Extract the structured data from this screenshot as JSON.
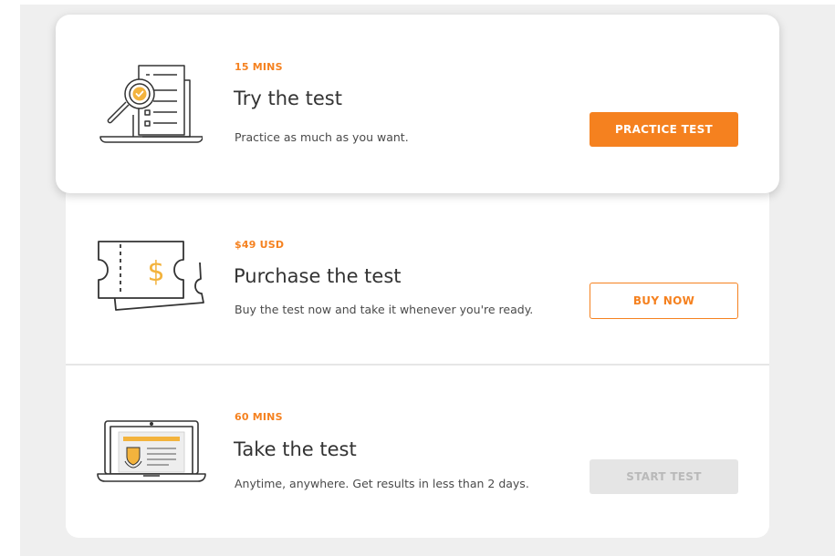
{
  "colors": {
    "accent": "#f5811f",
    "illustration_accent": "#f3b33d",
    "disabled_bg": "#e5e5e5",
    "disabled_text": "#b9b9b9",
    "page_bg": "#efefef"
  },
  "steps": [
    {
      "meta": "15 MINS",
      "title": "Try the test",
      "description": "Practice as much as you want.",
      "button_label": "PRACTICE TEST",
      "button_state": "primary",
      "icon": "laptop-magnifier-checklist-icon"
    },
    {
      "meta": "$49 USD",
      "title": "Purchase the test",
      "description": "Buy the test now and take it whenever you're ready.",
      "button_label": "BUY NOW",
      "button_state": "outline",
      "icon": "dollar-ticket-icon"
    },
    {
      "meta": "60 MINS",
      "title": "Take the test",
      "description": "Anytime, anywhere. Get results in less than 2 days.",
      "button_label": "START TEST",
      "button_state": "disabled",
      "icon": "laptop-certificate-icon"
    }
  ]
}
